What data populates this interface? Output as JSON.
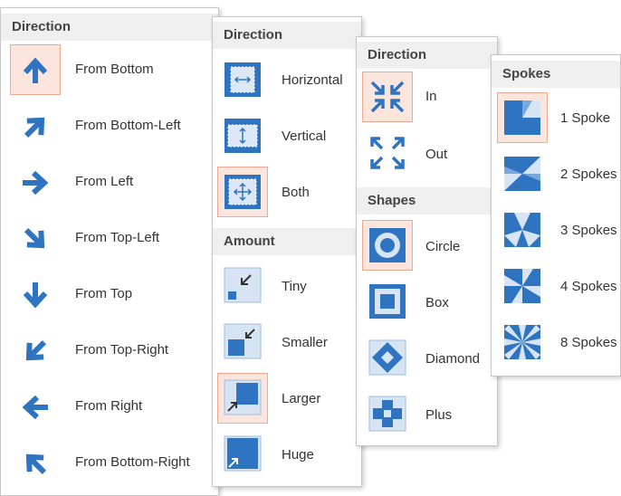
{
  "colors": {
    "accent": "#2f74c0",
    "selected_bg": "#fbe5dd",
    "selected_border": "#f0a890",
    "header_bg": "#efefef"
  },
  "panel1": {
    "header": "Direction",
    "items": [
      {
        "label": "From Bottom",
        "icon": "arrow-up-icon",
        "selected": true
      },
      {
        "label": "From Bottom-Left",
        "icon": "arrow-up-right-icon"
      },
      {
        "label": "From Left",
        "icon": "arrow-right-icon"
      },
      {
        "label": "From Top-Left",
        "icon": "arrow-down-right-icon"
      },
      {
        "label": "From Top",
        "icon": "arrow-down-icon"
      },
      {
        "label": "From Top-Right",
        "icon": "arrow-down-left-icon"
      },
      {
        "label": "From Right",
        "icon": "arrow-left-icon"
      },
      {
        "label": "From Bottom-Right",
        "icon": "arrow-up-left-icon"
      }
    ]
  },
  "panel2": {
    "direction_header": "Direction",
    "direction_items": [
      {
        "label": "Horizontal",
        "icon": "horizontal-split-icon"
      },
      {
        "label": "Vertical",
        "icon": "vertical-split-icon"
      },
      {
        "label": "Both",
        "icon": "both-directions-icon",
        "selected": true
      }
    ],
    "amount_header": "Amount",
    "amount_items": [
      {
        "label": "Tiny",
        "icon": "tiny-amount-icon"
      },
      {
        "label": "Smaller",
        "icon": "smaller-amount-icon"
      },
      {
        "label": "Larger",
        "icon": "larger-amount-icon",
        "selected": true
      },
      {
        "label": "Huge",
        "icon": "huge-amount-icon"
      }
    ]
  },
  "panel3": {
    "direction_header": "Direction",
    "direction_items": [
      {
        "label": "In",
        "icon": "zoom-in-arrows-icon",
        "selected": true
      },
      {
        "label": "Out",
        "icon": "zoom-out-arrows-icon"
      }
    ],
    "shapes_header": "Shapes",
    "shapes_items": [
      {
        "label": "Circle",
        "icon": "circle-shape-icon",
        "selected": true
      },
      {
        "label": "Box",
        "icon": "box-shape-icon"
      },
      {
        "label": "Diamond",
        "icon": "diamond-shape-icon"
      },
      {
        "label": "Plus",
        "icon": "plus-shape-icon"
      }
    ]
  },
  "panel4": {
    "header": "Spokes",
    "items": [
      {
        "label": "1 Spoke",
        "icon": "one-spoke-icon",
        "selected": true
      },
      {
        "label": "2 Spokes",
        "icon": "two-spokes-icon"
      },
      {
        "label": "3 Spokes",
        "icon": "three-spokes-icon"
      },
      {
        "label": "4 Spokes",
        "icon": "four-spokes-icon"
      },
      {
        "label": "8 Spokes",
        "icon": "eight-spokes-icon"
      }
    ]
  }
}
